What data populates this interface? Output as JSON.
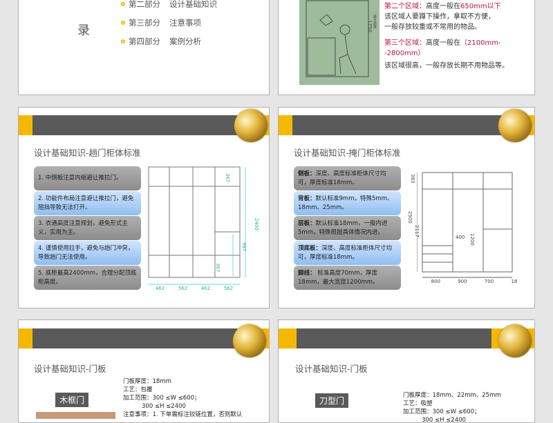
{
  "slide1": {
    "side_char": "录",
    "items": [
      {
        "part": "第二部分",
        "topic": "设计基础知识"
      },
      {
        "part": "第三部分",
        "topic": "注意事项"
      },
      {
        "part": "第四部分",
        "topic": "案例分析"
      }
    ]
  },
  "slide2": {
    "figure_labels": [
      "1750",
      "最大高度"
    ],
    "zone2_head": "第二个区域：",
    "zone2_text_a": "高度一般在",
    "zone2_value": "650mm以下",
    "zone2_desc1": "该区域人要蹲下操作，拿取不方便，",
    "zone2_desc2": "一般存放较重或不常用的物品。",
    "zone3_head": "第三个区域：",
    "zone3_text_a": "高度一般在",
    "zone3_value": "（2100mm--2800mm）",
    "zone3_desc": "该区域很高，一般存放长期不用物品等。"
  },
  "slide3": {
    "title": "设计基础知识-趟门柜体标准",
    "points": [
      "1. 中侧板注意内缩避让推拉门。",
      "2. 功能件布局注意避让推拉门，避免阻挡导致无法打开。",
      "3. 衣通高度注意规划，避免形式主义，实用为主。",
      "4. 谨慎使用拉手，避免与趟门冲突，导致趟门无法使用。",
      "5. 底柜最高2400mm，合理分配顶底柜高度。"
    ],
    "dims": {
      "top": "367",
      "height": "2400",
      "mid": "987",
      "low": "367",
      "widths": [
        "462",
        "562",
        "462",
        "562"
      ]
    }
  },
  "slide4": {
    "title": "设计基础知识-掩门柜体标准",
    "points": [
      {
        "head": "侧板：",
        "text": "深度、高度标准柜体尺寸均可，厚度标准18mm。"
      },
      {
        "head": "背板：",
        "text": "默认标准9mm，特殊5mm、18mm、25mm。"
      },
      {
        "head": "层板：",
        "text": "默认标准18mm，一般内进5mm，特殊根据具体情况内进。"
      },
      {
        "head": "顶底板：",
        "text": "深度、高度标准柜体尺寸均可，厚度标准18mm。"
      },
      {
        "head": "脚线：",
        "text": " 标准高度70mm，厚度18mm，最大宽度1200mm。"
      }
    ],
    "dims": {
      "top": "383",
      "total": "2500",
      "inner": "2117",
      "shelf": "400",
      "rod": "1200",
      "widths": [
        "800",
        "900",
        "700",
        "18"
      ]
    }
  },
  "slide5": {
    "title": "设计基础知识-门板",
    "tag": "木框门",
    "spec": [
      "门板厚度：18mm",
      "工艺：包覆",
      "加工范围：300 ≤W ≤600；",
      "          300 ≤H ≤2400",
      "注意事项：1. 下单需标注铰链位置，否则默认"
    ]
  },
  "slide6": {
    "title": "设计基础知识-门板",
    "tag": "刀型门",
    "spec": [
      "门板厚度：18mm、22mm、25mm",
      "工艺：吸塑",
      "加工范围：300 ≤W ≤600；",
      "          300 ≤H ≤2400"
    ]
  },
  "colors": {
    "accent": "#f5b800",
    "bar": "#5a5a5a",
    "highlight": "#c0143c"
  }
}
